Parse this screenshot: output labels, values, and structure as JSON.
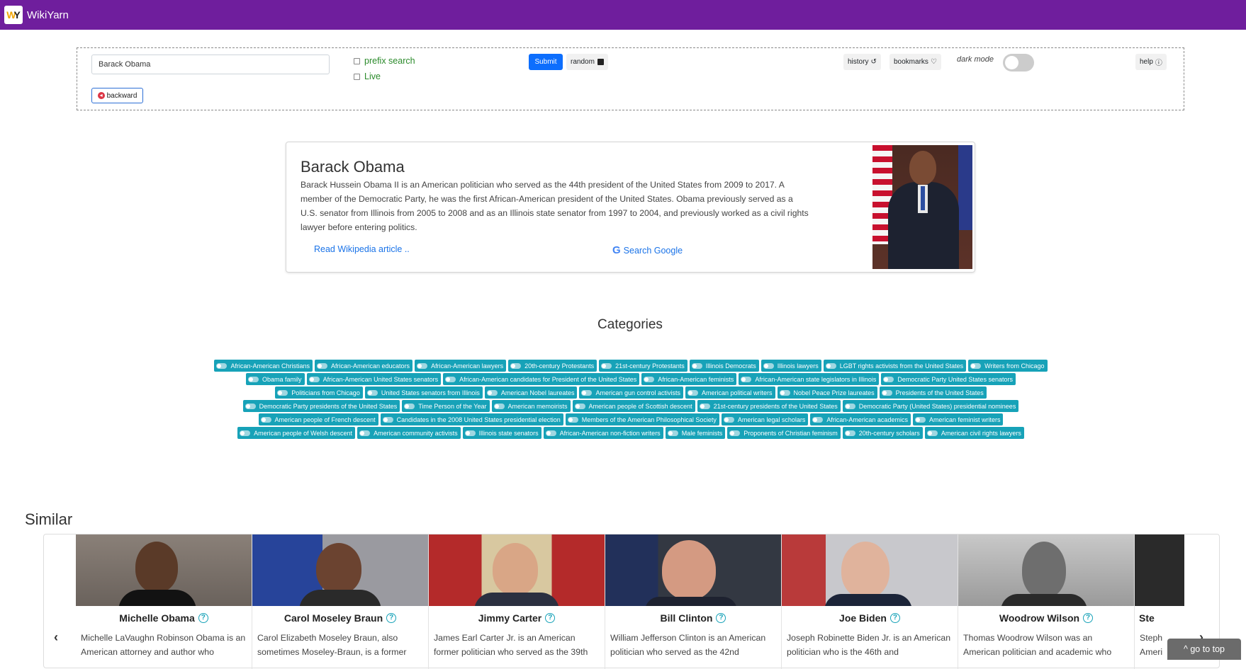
{
  "app": {
    "brand": "WikiYarn",
    "logo_text_w": "W",
    "logo_text_y": "Y"
  },
  "search": {
    "query": "Barack Obama",
    "prefix_label": "prefix search",
    "live_label": "Live",
    "submit_label": "Submit",
    "random_label": "random",
    "backward_label": "backward",
    "history_label": "history",
    "bookmarks_label": "bookmarks",
    "darkmode_label": "dark mode",
    "darkmode_on": false,
    "help_label": "help"
  },
  "article": {
    "title": "Barack Obama",
    "description": "Barack Hussein Obama II is an American politician who served as the 44th president of the United States from 2009 to 2017. A member of the Democratic Party, he was the first African-American president of the United States. Obama previously served as a U.S. senator from Illinois from 2005 to 2008 and as an Illinois state senator from 1997 to 2004, and previously worked as a civil rights lawyer before entering politics.",
    "read_link": "Read Wikipedia article ..",
    "google_link": "Search Google"
  },
  "categories": {
    "heading": "Categories",
    "items": [
      "African-American Christians",
      "African-American educators",
      "African-American lawyers",
      "20th-century Protestants",
      "21st-century Protestants",
      "Illinois Democrats",
      "Illinois lawyers",
      "LGBT rights activists from the United States",
      "Writers from Chicago",
      "Obama family",
      "African-American United States senators",
      "African-American candidates for President of the United States",
      "African-American feminists",
      "African-American state legislators in Illinois",
      "Democratic Party United States senators",
      "Politicians from Chicago",
      "United States senators from Illinois",
      "American Nobel laureates",
      "American gun control activists",
      "American political writers",
      "Nobel Peace Prize laureates",
      "Presidents of the United States",
      "Democratic Party presidents of the United States",
      "Time Person of the Year",
      "American memoirists",
      "American people of Scottish descent",
      "21st-century presidents of the United States",
      "Democratic Party (United States) presidential nominees",
      "American people of French descent",
      "Candidates in the 2008 United States presidential election",
      "Members of the American Philosophical Society",
      "American legal scholars",
      "African-American academics",
      "American feminist writers",
      "American people of Welsh descent",
      "American community activists",
      "Illinois state senators",
      "African-American non-fiction writers",
      "Male feminists",
      "Proponents of Christian feminism",
      "20th-century scholars",
      "American civil rights lawyers"
    ]
  },
  "similar": {
    "heading": "Similar",
    "items": [
      {
        "name": "Michelle Obama",
        "desc": "Michelle LaVaughn Robinson Obama is an American attorney and author who"
      },
      {
        "name": "Carol Moseley Braun",
        "desc": "Carol Elizabeth Moseley Braun, also sometimes Moseley-Braun, is a former"
      },
      {
        "name": "Jimmy Carter",
        "desc": "James Earl Carter Jr. is an American former politician who served as the 39th"
      },
      {
        "name": "Bill Clinton",
        "desc": "William Jefferson Clinton is an American politician who served as the 42nd"
      },
      {
        "name": "Joe Biden",
        "desc": "Joseph Robinette Biden Jr. is an American politician who is the 46th and"
      },
      {
        "name": "Woodrow Wilson",
        "desc": "Thomas Woodrow Wilson was an American politician and academic who"
      },
      {
        "name": "Ste",
        "desc": "Steph Ameri"
      }
    ],
    "prev_label": "‹",
    "next_label": "›"
  },
  "footer": {
    "go_top_label": "^ go to top"
  },
  "colors": {
    "navbar": "#6f1e9d",
    "tag": "#17a2b8",
    "submit": "#0d6efd"
  }
}
